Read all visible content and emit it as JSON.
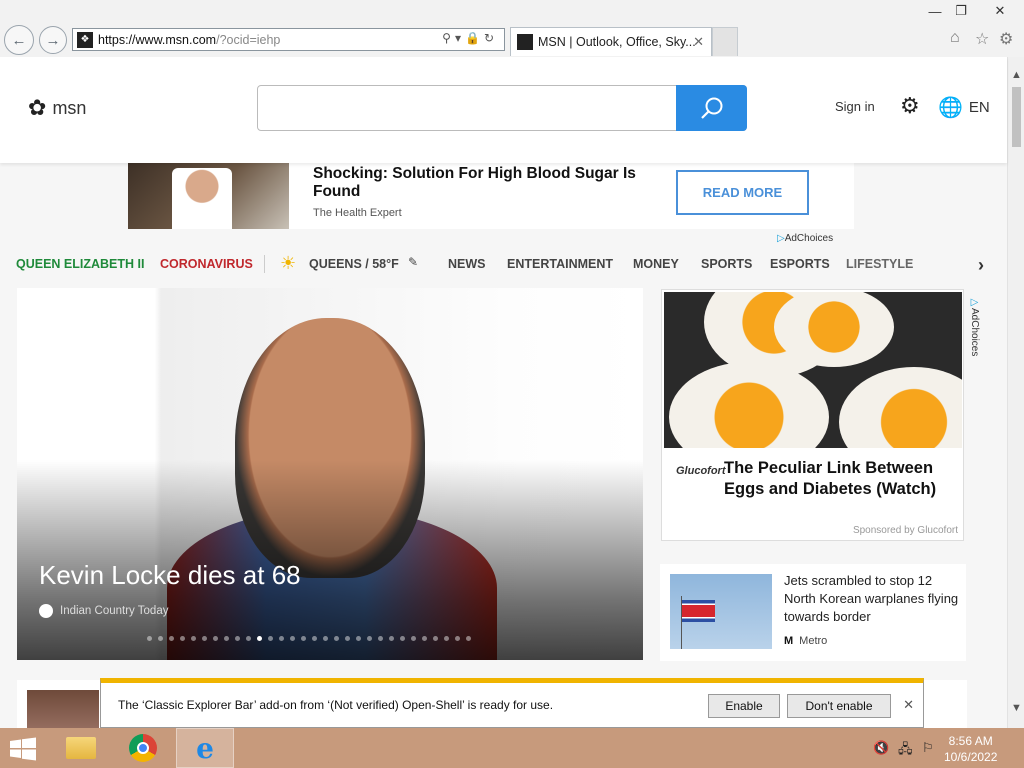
{
  "browser": {
    "url_host": "https://www.msn.com",
    "url_rest": "/?ocid=iehp",
    "tab_title": "MSN | Outlook, Office, Sky...",
    "window_controls": [
      "minimize-icon",
      "restore-icon",
      "close-icon"
    ]
  },
  "msn": {
    "logo_text": "msn",
    "search_placeholder": "",
    "sign_in": "Sign in",
    "language": "EN"
  },
  "ad_banner": {
    "title": "Shocking: Solution For High Blood Sugar Is Found",
    "source": "The Health Expert",
    "cta": "READ MORE",
    "adchoices": "AdChoices"
  },
  "nav": {
    "items": [
      {
        "label": "QUEEN ELIZABETH II",
        "color": "#1f8a3a"
      },
      {
        "label": "CORONAVIRUS",
        "color": "#c0282d"
      },
      {
        "label": "QUEENS / 58°F",
        "color": "#444444"
      },
      {
        "label": "NEWS",
        "color": "#444444"
      },
      {
        "label": "ENTERTAINMENT",
        "color": "#444444"
      },
      {
        "label": "MONEY",
        "color": "#444444"
      },
      {
        "label": "SPORTS",
        "color": "#444444"
      },
      {
        "label": "ESPORTS",
        "color": "#444444"
      },
      {
        "label": "LIFESTYLE",
        "color": "#444444"
      }
    ]
  },
  "hero": {
    "headline": "Kevin Locke dies at 68",
    "source": "Indian Country Today",
    "slide_count": 30,
    "active_slide": 10
  },
  "side_ad": {
    "brand": "Glucofort",
    "title": "The Peculiar Link Between Eggs and Diabetes (Watch)",
    "sponsored": "Sponsored by Glucofort",
    "adchoices": "AdChoices"
  },
  "jets_card": {
    "title": "Jets scrambled to stop 12 North Korean warplanes flying towards border",
    "source": "Metro"
  },
  "notification": {
    "message": "The ‘Classic Explorer Bar’ add-on from ‘(Not verified) Open-Shell’ is ready for use.",
    "enable": "Enable",
    "dont_enable": "Don't enable"
  },
  "taskbar": {
    "time": "8:56 AM",
    "date": "10/6/2022"
  }
}
